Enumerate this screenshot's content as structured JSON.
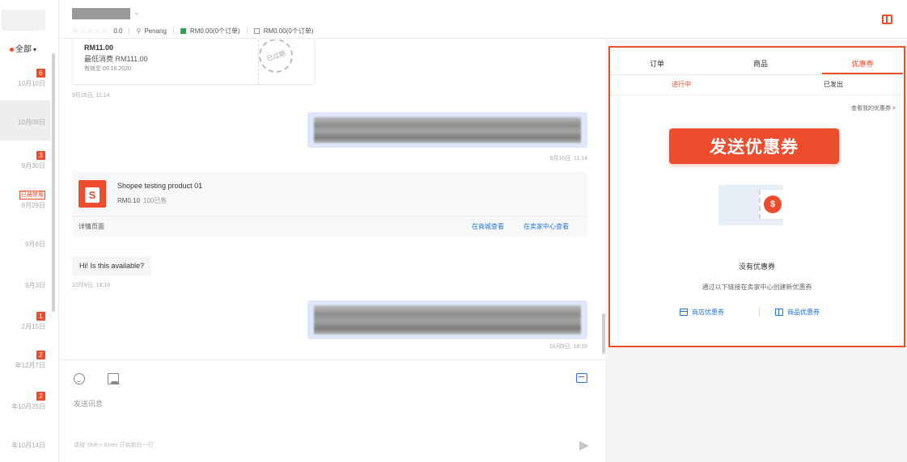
{
  "sidebar": {
    "filter_label": "全部",
    "conversations": [
      {
        "badge": "6",
        "date": "10月10日"
      },
      {
        "date": "10月09日"
      },
      {
        "badge": "3",
        "date": "9月30日"
      },
      {
        "tag": "已被禁用",
        "date": "9月29日"
      },
      {
        "date": "9月8日"
      },
      {
        "date": "9月3日"
      },
      {
        "badge": "1",
        "date": "2月15日"
      },
      {
        "badge": "2",
        "date": "年12月7日"
      },
      {
        "badge": "2",
        "date": "年10月25日"
      },
      {
        "date": "年10月14日"
      }
    ]
  },
  "header": {
    "stars": "☆☆☆☆☆",
    "rating": "0.0",
    "location": "Penang",
    "completed_orders": "RM0.00(0个订单)",
    "other_orders": "RM0.00(0个订单)"
  },
  "chat": {
    "voucher_card": {
      "amount": "RM11.00",
      "min_spend": "最低消费 RM111.00",
      "expiry": "有效至 09.16.2020",
      "stamp": "已过期"
    },
    "voucher_timestamp": "9月16日, 11:14",
    "out_msg_1_timestamp": "9月16日, 11:14",
    "product": {
      "name": "Shopee testing product 01",
      "price": "RM0.10",
      "sold": "100已售",
      "detail_label": "详情页面",
      "link_mall": "在商城查看",
      "link_seller": "在卖家中心查看"
    },
    "incoming_message": "Hi! Is this available?",
    "incoming_timestamp": "10月9日, 18:18",
    "out_msg_2_timestamp": "10月9日, 18:18"
  },
  "composer": {
    "placeholder": "发送讯息",
    "hint": "请按 Shift + Enter 开始新的一行"
  },
  "right_panel": {
    "tabs": [
      "订单",
      "商品",
      "优惠券"
    ],
    "active_tab": "优惠券",
    "sub_tabs": [
      "进行中",
      "已发出"
    ],
    "view_my_vouchers": "查看我的优惠券 >",
    "send_voucher_button": "发送优惠券",
    "coin_symbol": "$",
    "empty_title": "没有优惠券",
    "empty_desc": "通过以下链接在卖家中心创建新优惠券",
    "link_shop_voucher": "商店优惠券",
    "link_product_voucher": "商品优惠券",
    "accent_color": "#ee4d2d"
  }
}
